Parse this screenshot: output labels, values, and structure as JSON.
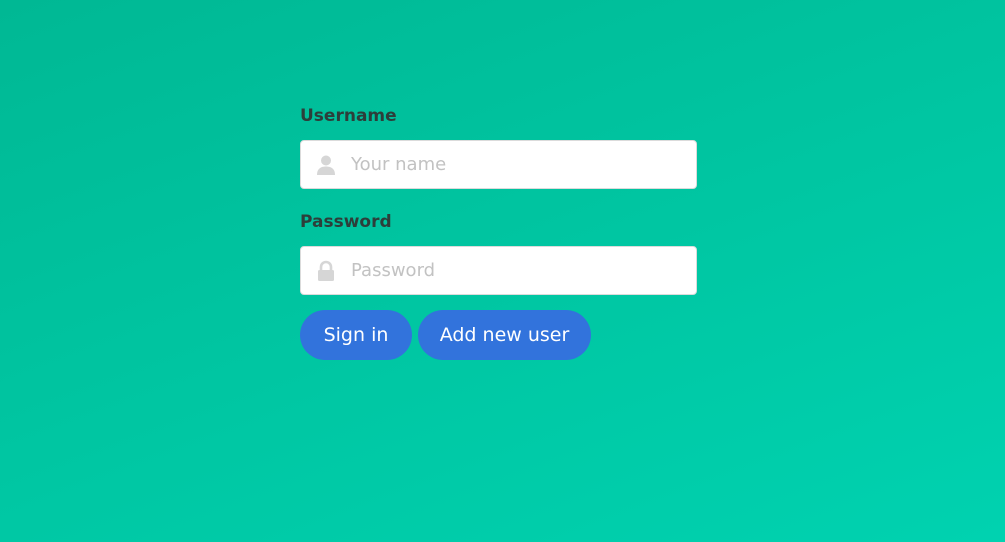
{
  "form": {
    "username_label": "Username",
    "username_placeholder": "Your name",
    "username_value": "",
    "password_label": "Password",
    "password_placeholder": "Password",
    "password_value": "",
    "signin_label": "Sign in",
    "add_user_label": "Add new user"
  },
  "icons": {
    "username_icon": "user-icon",
    "password_icon": "lock-icon"
  },
  "colors": {
    "background_start": "#00b894",
    "background_end": "#00d2b0",
    "button": "#3273dc",
    "label_text": "#2d3e3a",
    "placeholder": "#c2c2c2",
    "icon": "#dbdbdb"
  }
}
